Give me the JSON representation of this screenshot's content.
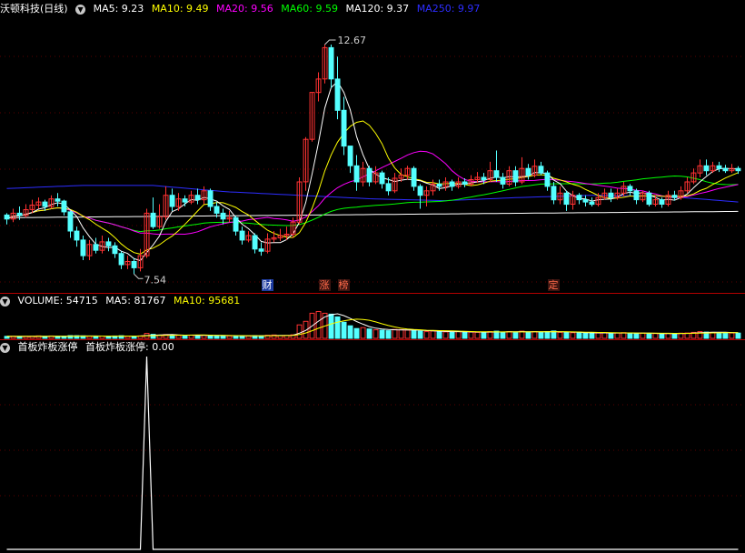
{
  "title": "沃顿科技(日线)",
  "colors": {
    "up": "#ff3232",
    "down": "#54ffff",
    "ma5": "#ffffff",
    "ma10": "#ffff00",
    "ma20": "#ff00ff",
    "ma60": "#00ff00",
    "ma120": "#ffffff",
    "ma250": "#2d2dff"
  },
  "main_header": {
    "ma5": "MA5: 9.23",
    "ma10": "MA10: 9.49",
    "ma20": "MA20: 9.56",
    "ma60": "MA60: 9.59",
    "ma120": "MA120: 9.37",
    "ma250": "MA250: 9.97"
  },
  "volume_header": {
    "vol": "VOLUME: 54715",
    "ma5": "MA5: 81767",
    "ma10": "MA10: 95681"
  },
  "indicator_header": {
    "name": "首板炸板涨停",
    "value": "首板炸板涨停: 0.00"
  },
  "annotations": {
    "high": "12.67",
    "low": "7.54"
  },
  "event_markers": [
    {
      "label": "财",
      "type": "finance",
      "index": 41
    },
    {
      "label": "涨",
      "type": "limit-up",
      "index": 50
    },
    {
      "label": "榜",
      "type": "list",
      "index": 53
    },
    {
      "label": "定",
      "type": "placement",
      "index": 86
    }
  ],
  "chart_data": [
    {
      "type": "candlestick",
      "title": "沃顿科技(日线)",
      "ylim": [
        7.2,
        13.3
      ],
      "bars": [
        [
          8.86,
          8.77,
          8.9,
          8.65
        ],
        [
          8.77,
          8.9,
          9.0,
          8.7
        ],
        [
          8.9,
          8.85,
          9.05,
          8.75
        ],
        [
          8.85,
          8.98,
          9.1,
          8.8
        ],
        [
          8.98,
          9.08,
          9.2,
          8.9
        ],
        [
          9.08,
          9.15,
          9.25,
          9.0
        ],
        [
          9.15,
          9.05,
          9.2,
          8.95
        ],
        [
          9.05,
          9.22,
          9.3,
          9.0
        ],
        [
          9.22,
          9.17,
          9.35,
          9.05
        ],
        [
          9.17,
          8.93,
          9.2,
          8.85
        ],
        [
          8.93,
          8.5,
          8.95,
          8.35
        ],
        [
          8.5,
          8.3,
          8.6,
          8.15
        ],
        [
          8.3,
          7.95,
          8.4,
          7.85
        ],
        [
          7.95,
          8.2,
          8.3,
          7.85
        ],
        [
          8.2,
          8.07,
          8.35,
          8.0
        ],
        [
          8.07,
          8.26,
          8.4,
          8.0
        ],
        [
          8.26,
          8.17,
          8.35,
          8.05
        ],
        [
          8.17,
          8.0,
          8.25,
          7.9
        ],
        [
          8.0,
          7.75,
          8.05,
          7.65
        ],
        [
          7.75,
          7.82,
          7.95,
          7.65
        ],
        [
          7.82,
          7.68,
          7.9,
          7.54
        ],
        [
          7.68,
          7.95,
          8.1,
          7.6
        ],
        [
          7.95,
          8.9,
          9.0,
          7.9
        ],
        [
          8.9,
          8.6,
          9.25,
          8.55
        ],
        [
          8.6,
          8.82,
          9.1,
          8.55
        ],
        [
          8.82,
          9.3,
          9.5,
          8.75
        ],
        [
          9.3,
          9.05,
          9.45,
          8.95
        ],
        [
          9.05,
          9.22,
          9.35,
          8.95
        ],
        [
          9.22,
          9.15,
          9.3,
          9.05
        ],
        [
          9.15,
          9.3,
          9.4,
          9.1
        ],
        [
          9.3,
          9.2,
          9.45,
          9.1
        ],
        [
          9.2,
          9.4,
          9.5,
          9.1
        ],
        [
          9.4,
          9.05,
          9.45,
          8.95
        ],
        [
          9.05,
          8.9,
          9.15,
          8.8
        ],
        [
          8.9,
          8.77,
          9.0,
          8.65
        ],
        [
          8.77,
          8.8,
          8.95,
          8.7
        ],
        [
          8.8,
          8.5,
          8.85,
          8.4
        ],
        [
          8.5,
          8.3,
          8.6,
          8.2
        ],
        [
          8.3,
          8.4,
          8.5,
          8.25
        ],
        [
          8.4,
          8.1,
          8.45,
          8.0
        ],
        [
          8.1,
          8.05,
          8.25,
          7.95
        ],
        [
          8.05,
          8.32,
          8.45,
          8.0
        ],
        [
          8.32,
          8.35,
          8.5,
          8.25
        ],
        [
          8.35,
          8.4,
          8.55,
          8.28
        ],
        [
          8.4,
          8.43,
          8.6,
          8.3
        ],
        [
          8.43,
          8.7,
          8.8,
          8.35
        ],
        [
          8.7,
          9.6,
          9.7,
          8.65
        ],
        [
          9.6,
          10.55,
          10.6,
          9.4
        ],
        [
          10.55,
          11.6,
          11.6,
          10.5
        ],
        [
          11.6,
          11.9,
          12.05,
          11.4
        ],
        [
          11.9,
          12.6,
          12.67,
          11.8
        ],
        [
          12.6,
          11.9,
          12.67,
          11.7
        ],
        [
          11.9,
          11.2,
          12.4,
          11.0
        ],
        [
          11.2,
          10.4,
          11.5,
          10.2
        ],
        [
          10.4,
          9.96,
          10.4,
          9.8
        ],
        [
          9.96,
          9.6,
          10.2,
          9.4
        ],
        [
          9.6,
          9.9,
          10.05,
          9.5
        ],
        [
          9.9,
          9.6,
          9.96,
          9.5
        ],
        [
          9.6,
          9.8,
          9.95,
          9.55
        ],
        [
          9.8,
          9.56,
          9.85,
          9.45
        ],
        [
          9.56,
          9.4,
          9.7,
          9.3
        ],
        [
          9.4,
          9.68,
          9.8,
          9.35
        ],
        [
          9.68,
          9.75,
          9.9,
          9.6
        ],
        [
          9.75,
          9.9,
          9.96,
          9.65
        ],
        [
          9.9,
          9.5,
          9.95,
          9.4
        ],
        [
          9.5,
          9.3,
          9.55,
          9.0
        ],
        [
          9.3,
          9.4,
          9.5,
          9.05
        ],
        [
          9.4,
          9.55,
          9.65,
          9.3
        ],
        [
          9.55,
          9.5,
          9.65,
          9.4
        ],
        [
          9.5,
          9.6,
          9.7,
          9.4
        ],
        [
          9.6,
          9.5,
          9.65,
          9.4
        ],
        [
          9.5,
          9.6,
          9.7,
          9.45
        ],
        [
          9.6,
          9.55,
          9.68,
          9.48
        ],
        [
          9.55,
          9.65,
          9.75,
          9.5
        ],
        [
          9.65,
          9.7,
          9.82,
          9.58
        ],
        [
          9.7,
          9.65,
          9.8,
          9.55
        ],
        [
          9.65,
          9.85,
          10.05,
          9.6
        ],
        [
          9.85,
          9.7,
          10.3,
          9.6
        ],
        [
          9.7,
          9.55,
          9.8,
          9.45
        ],
        [
          9.55,
          9.85,
          9.95,
          9.5
        ],
        [
          9.85,
          9.6,
          9.95,
          9.5
        ],
        [
          9.6,
          9.9,
          10.15,
          9.55
        ],
        [
          9.9,
          9.75,
          10.0,
          9.65
        ],
        [
          9.75,
          9.95,
          10.1,
          9.7
        ],
        [
          9.95,
          9.8,
          10.05,
          9.75
        ],
        [
          9.8,
          9.5,
          9.85,
          9.4
        ],
        [
          9.5,
          9.2,
          9.6,
          9.1
        ],
        [
          9.2,
          9.35,
          9.5,
          9.1
        ],
        [
          9.35,
          9.1,
          9.4,
          8.95
        ],
        [
          9.1,
          9.3,
          9.4,
          8.98
        ],
        [
          9.3,
          9.2,
          9.35,
          9.1
        ],
        [
          9.2,
          9.15,
          9.3,
          9.05
        ],
        [
          9.15,
          9.1,
          9.25,
          9.05
        ],
        [
          9.1,
          9.25,
          9.35,
          9.05
        ],
        [
          9.25,
          9.35,
          9.45,
          9.2
        ],
        [
          9.35,
          9.25,
          9.45,
          9.15
        ],
        [
          9.25,
          9.35,
          9.45,
          9.2
        ],
        [
          9.35,
          9.5,
          9.6,
          9.28
        ],
        [
          9.5,
          9.4,
          9.55,
          9.3
        ],
        [
          9.4,
          9.2,
          9.45,
          9.1
        ],
        [
          9.2,
          9.35,
          9.4,
          9.15
        ],
        [
          9.35,
          9.1,
          9.4,
          9.05
        ],
        [
          9.1,
          9.2,
          9.3,
          9.05
        ],
        [
          9.2,
          9.1,
          9.25,
          9.02
        ],
        [
          9.1,
          9.3,
          9.4,
          9.05
        ],
        [
          9.3,
          9.25,
          9.4,
          9.18
        ],
        [
          9.25,
          9.4,
          9.5,
          9.2
        ],
        [
          9.4,
          9.6,
          9.7,
          9.35
        ],
        [
          9.6,
          9.8,
          9.9,
          9.55
        ],
        [
          9.8,
          9.96,
          10.1,
          9.7
        ],
        [
          9.96,
          9.85,
          10.1,
          9.75
        ],
        [
          9.85,
          9.96,
          10.05,
          9.8
        ],
        [
          9.96,
          9.9,
          10.05,
          9.82
        ],
        [
          9.9,
          9.85,
          9.98,
          9.8
        ],
        [
          9.85,
          9.9,
          10.0,
          9.8
        ],
        [
          9.9,
          9.85,
          9.95,
          9.78
        ]
      ],
      "ma120": [
        8.8,
        8.94
      ],
      "ma250": [
        9.45,
        9.52,
        9.52,
        9.38,
        9.3,
        9.22,
        9.18,
        9.25,
        9.3,
        9.28,
        9.15
      ]
    },
    {
      "type": "bar",
      "title": "VOLUME",
      "values": [
        45,
        48,
        42,
        47,
        50,
        55,
        43,
        52,
        48,
        46,
        60,
        58,
        55,
        47,
        44,
        50,
        46,
        52,
        58,
        45,
        50,
        55,
        110,
        90,
        70,
        85,
        75,
        65,
        60,
        70,
        62,
        68,
        65,
        60,
        55,
        52,
        58,
        55,
        50,
        60,
        55,
        70,
        75,
        60,
        65,
        80,
        300,
        380,
        560,
        600,
        560,
        540,
        480,
        360,
        280,
        220,
        240,
        210,
        190,
        180,
        170,
        200,
        195,
        185,
        175,
        160,
        150,
        165,
        155,
        145,
        140,
        150,
        145,
        140,
        135,
        130,
        150,
        160,
        140,
        150,
        140,
        160,
        145,
        150,
        140,
        150,
        165,
        135,
        130,
        125,
        130,
        120,
        115,
        120,
        125,
        115,
        120,
        128,
        115,
        110,
        118,
        105,
        108,
        100,
        110,
        108,
        115,
        120,
        135,
        150,
        140,
        135,
        130,
        125,
        120,
        118
      ],
      "ma5_value": 81767,
      "ma10_value": 95681,
      "ylim": [
        0,
        650
      ]
    },
    {
      "type": "line",
      "title": "首板炸板涨停",
      "spike_index": 22,
      "ylim": [
        0,
        1
      ]
    }
  ]
}
